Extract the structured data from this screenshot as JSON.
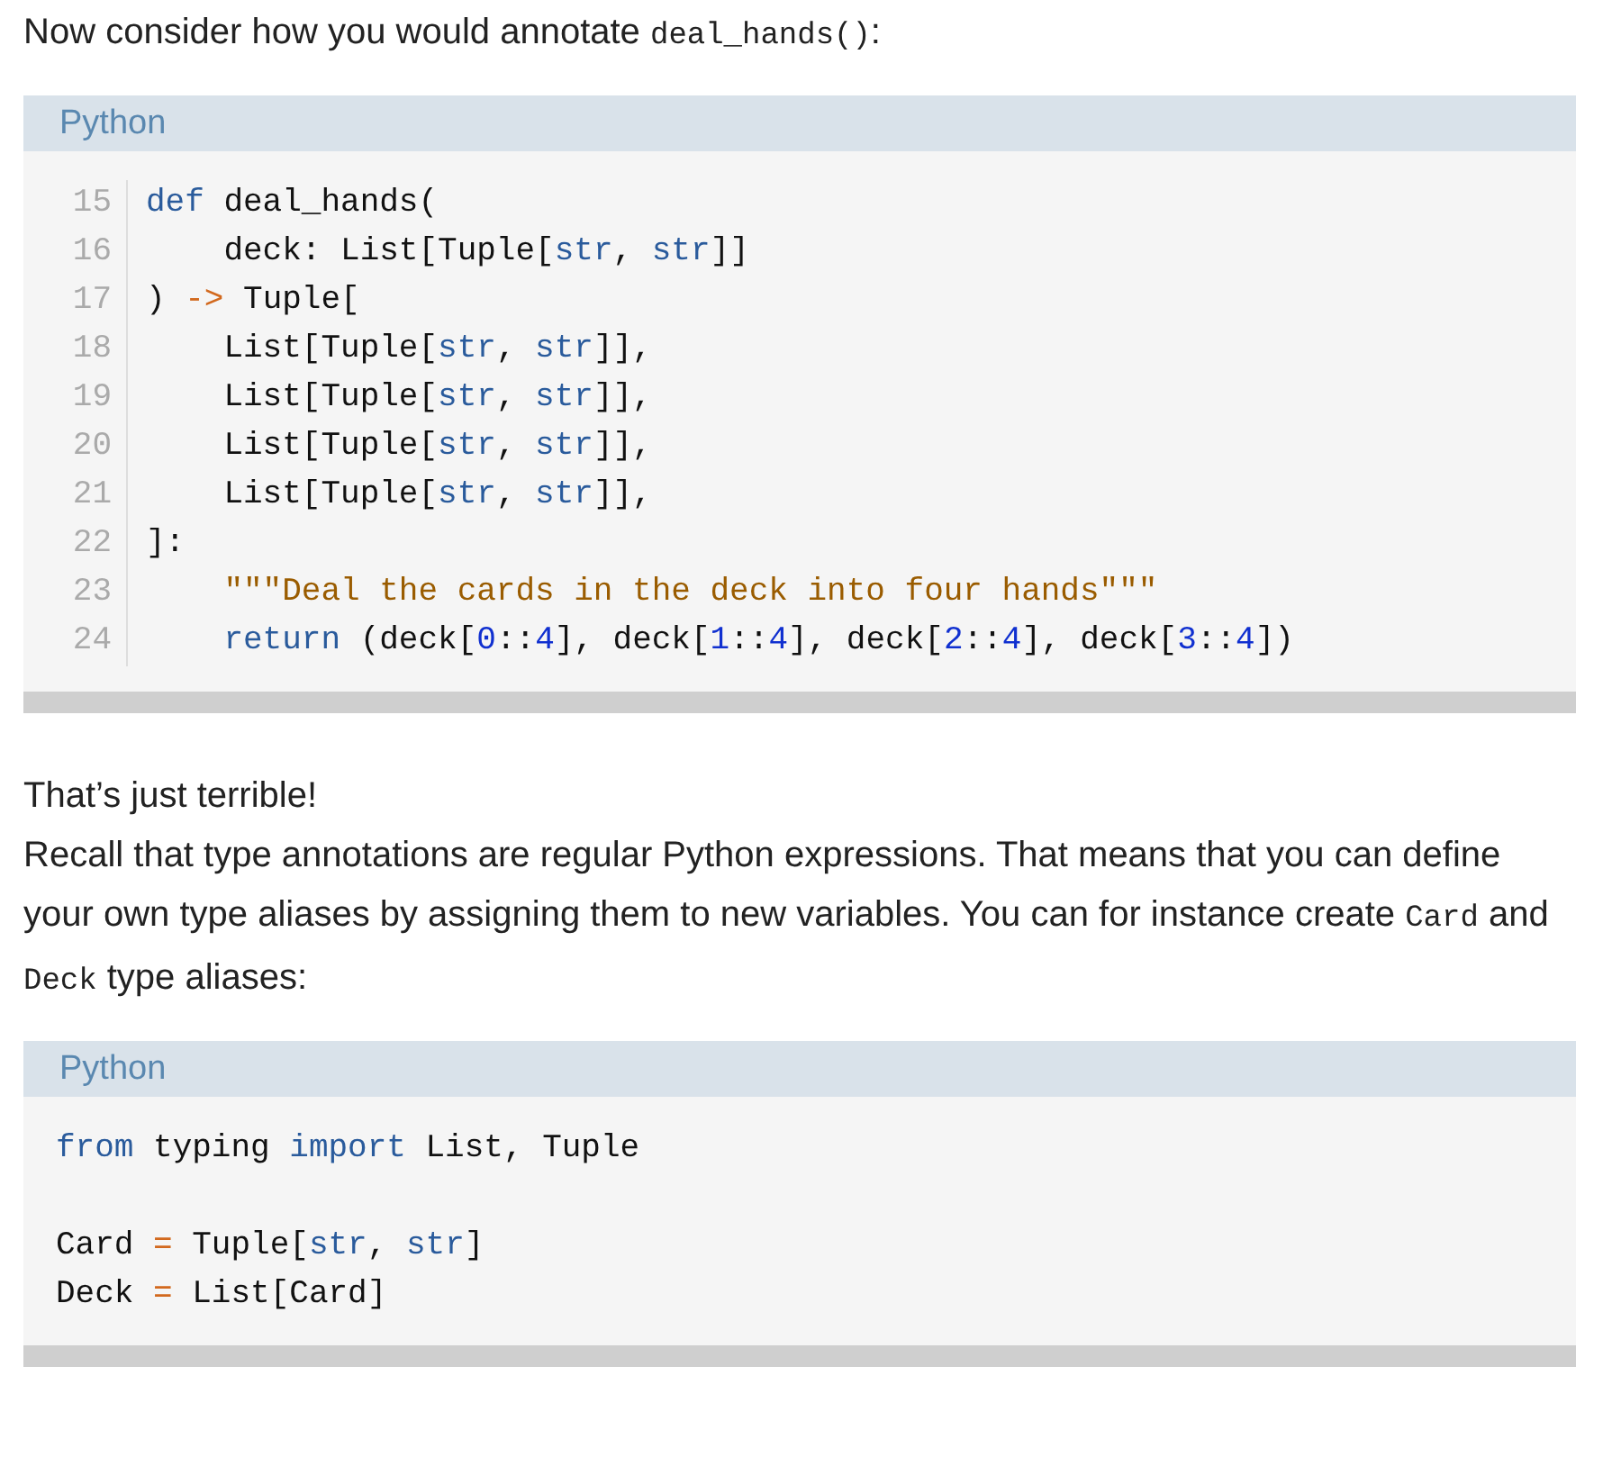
{
  "blocks": [
    {
      "kind": "paragraph",
      "parts": [
        {
          "text": "Now consider how you would annotate ",
          "code": false
        },
        {
          "text": "deal_hands()",
          "code": true
        },
        {
          "text": ":",
          "code": false
        }
      ]
    },
    {
      "kind": "code",
      "language": "Python",
      "lines": [
        {
          "kind": "code",
          "number": "15",
          "tokens": [
            {
              "kind": "kw",
              "s": "def"
            },
            {
              "kind": "plain",
              "s": " deal_hands("
            }
          ]
        },
        {
          "kind": "code",
          "number": "16",
          "tokens": [
            {
              "kind": "plain",
              "s": "    deck: List[Tuple["
            },
            {
              "kind": "bi",
              "s": "str"
            },
            {
              "kind": "plain",
              "s": ", "
            },
            {
              "kind": "bi",
              "s": "str"
            },
            {
              "kind": "plain",
              "s": "]]"
            }
          ]
        },
        {
          "kind": "code",
          "number": "17",
          "tokens": [
            {
              "kind": "plain",
              "s": ") "
            },
            {
              "kind": "op",
              "s": "->"
            },
            {
              "kind": "plain",
              "s": " Tuple["
            }
          ]
        },
        {
          "kind": "code",
          "number": "18",
          "tokens": [
            {
              "kind": "plain",
              "s": "    List[Tuple["
            },
            {
              "kind": "bi",
              "s": "str"
            },
            {
              "kind": "plain",
              "s": ", "
            },
            {
              "kind": "bi",
              "s": "str"
            },
            {
              "kind": "plain",
              "s": "]],"
            }
          ]
        },
        {
          "kind": "code",
          "number": "19",
          "tokens": [
            {
              "kind": "plain",
              "s": "    List[Tuple["
            },
            {
              "kind": "bi",
              "s": "str"
            },
            {
              "kind": "plain",
              "s": ", "
            },
            {
              "kind": "bi",
              "s": "str"
            },
            {
              "kind": "plain",
              "s": "]],"
            }
          ]
        },
        {
          "kind": "code",
          "number": "20",
          "tokens": [
            {
              "kind": "plain",
              "s": "    List[Tuple["
            },
            {
              "kind": "bi",
              "s": "str"
            },
            {
              "kind": "plain",
              "s": ", "
            },
            {
              "kind": "bi",
              "s": "str"
            },
            {
              "kind": "plain",
              "s": "]],"
            }
          ]
        },
        {
          "kind": "code",
          "number": "21",
          "tokens": [
            {
              "kind": "plain",
              "s": "    List[Tuple["
            },
            {
              "kind": "bi",
              "s": "str"
            },
            {
              "kind": "plain",
              "s": ", "
            },
            {
              "kind": "bi",
              "s": "str"
            },
            {
              "kind": "plain",
              "s": "]],"
            }
          ]
        },
        {
          "kind": "code",
          "number": "22",
          "tokens": [
            {
              "kind": "plain",
              "s": "]:"
            }
          ]
        },
        {
          "kind": "code",
          "number": "23",
          "indented": true,
          "tokens": [
            {
              "kind": "str",
              "s": "\"\"\"Deal the cards in the deck into four hands\"\"\""
            }
          ]
        },
        {
          "kind": "code",
          "number": "24",
          "indented": true,
          "tokens": [
            {
              "kind": "kw",
              "s": "return"
            },
            {
              "kind": "plain",
              "s": " (deck["
            },
            {
              "kind": "num",
              "s": "0"
            },
            {
              "kind": "plain",
              "s": "::"
            },
            {
              "kind": "num",
              "s": "4"
            },
            {
              "kind": "plain",
              "s": "], deck["
            },
            {
              "kind": "num",
              "s": "1"
            },
            {
              "kind": "plain",
              "s": "::"
            },
            {
              "kind": "num",
              "s": "4"
            },
            {
              "kind": "plain",
              "s": "], deck["
            },
            {
              "kind": "num",
              "s": "2"
            },
            {
              "kind": "plain",
              "s": "::"
            },
            {
              "kind": "num",
              "s": "4"
            },
            {
              "kind": "plain",
              "s": "], deck["
            },
            {
              "kind": "num",
              "s": "3"
            },
            {
              "kind": "plain",
              "s": "::"
            },
            {
              "kind": "num",
              "s": "4"
            },
            {
              "kind": "plain",
              "s": "])"
            }
          ]
        }
      ]
    },
    {
      "kind": "paragraph",
      "parts": [
        {
          "text": "That’s just terrible!",
          "code": false
        }
      ]
    },
    {
      "kind": "paragraph",
      "parts": [
        {
          "text": "Recall that type annotations are regular Python expressions. That means that you can define your own type aliases by assigning them to new variables. You can for instance create ",
          "code": false
        },
        {
          "text": "Card",
          "code": true
        },
        {
          "text": " and ",
          "code": false
        },
        {
          "text": "Deck",
          "code": true
        },
        {
          "text": " type aliases:",
          "code": false
        }
      ]
    },
    {
      "kind": "code",
      "language": "Python",
      "lines": [
        {
          "kind": "code",
          "tokens": [
            {
              "kind": "kw",
              "s": "from"
            },
            {
              "kind": "plain",
              "s": " typing "
            },
            {
              "kind": "kw",
              "s": "import"
            },
            {
              "kind": "plain",
              "s": " List, Tuple"
            }
          ]
        },
        {
          "kind": "blank"
        },
        {
          "kind": "code",
          "tokens": [
            {
              "kind": "plain",
              "s": "Card "
            },
            {
              "kind": "op",
              "s": "="
            },
            {
              "kind": "plain",
              "s": " Tuple["
            },
            {
              "kind": "bi",
              "s": "str"
            },
            {
              "kind": "plain",
              "s": ", "
            },
            {
              "kind": "bi",
              "s": "str"
            },
            {
              "kind": "plain",
              "s": "]"
            }
          ]
        },
        {
          "kind": "code",
          "tokens": [
            {
              "kind": "plain",
              "s": "Deck "
            },
            {
              "kind": "op",
              "s": "="
            },
            {
              "kind": "plain",
              "s": " List[Card]"
            }
          ]
        }
      ]
    }
  ]
}
